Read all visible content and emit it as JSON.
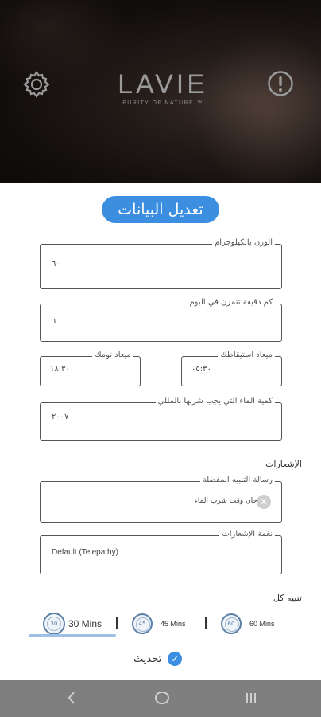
{
  "header": {
    "logo_word": "LAVIE",
    "logo_tagline": "PURITY OF NATURE ™",
    "settings_icon": "gear-icon",
    "info_icon": "exclamation-circle-icon"
  },
  "page_title": "تعديل البيانات",
  "form": {
    "weight": {
      "label": "الوزن بالكيلوجرام",
      "value": "٦٠"
    },
    "exercise": {
      "label": "كم دقيقة تتمرن في اليوم",
      "value": "٦"
    },
    "wake_time": {
      "label": "ميعاد استيقاظك",
      "value": "٠٥:٣٠"
    },
    "sleep_time": {
      "label": "ميعاد نومك",
      "value": "١٨:٣٠"
    },
    "water": {
      "label": "كمية الماء التي يجب شربها بالمللي",
      "value": "٢٠٠٧"
    }
  },
  "notifications": {
    "section_label": "الإشعارات",
    "message": {
      "label": "رسالة التنبيه المفضلة",
      "value": "حان وقت شرب الماء",
      "clear_icon": "clear-icon"
    },
    "tone": {
      "label": "نغمة الإشعارات",
      "value": "Default (Telepathy)"
    }
  },
  "interval": {
    "label": "تنبيه كل",
    "options": [
      {
        "dial": "30",
        "label": "30 Mins",
        "selected": true
      },
      {
        "dial": "45",
        "label": "45 Mins",
        "selected": false
      },
      {
        "dial": "60",
        "label": "60 Mins",
        "selected": false
      }
    ]
  },
  "update_label": "تحديث",
  "colors": {
    "accent": "#3c8fe0",
    "dial": "#5b7fa6",
    "navbar": "#7f7f7f"
  },
  "navbar": {
    "back_icon": "back-chevron-icon",
    "home_icon": "home-icon",
    "recents_icon": "recents-icon"
  }
}
